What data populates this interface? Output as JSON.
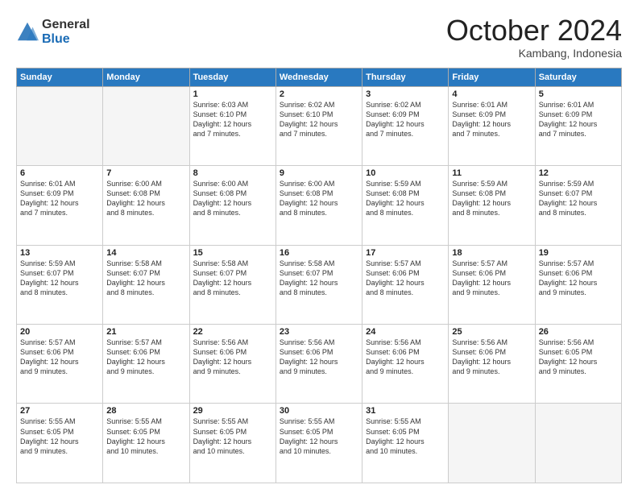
{
  "header": {
    "logo_general": "General",
    "logo_blue": "Blue",
    "month_title": "October 2024",
    "location": "Kambang, Indonesia"
  },
  "calendar": {
    "days_of_week": [
      "Sunday",
      "Monday",
      "Tuesday",
      "Wednesday",
      "Thursday",
      "Friday",
      "Saturday"
    ],
    "weeks": [
      [
        {
          "num": "",
          "info": "",
          "empty": true
        },
        {
          "num": "",
          "info": "",
          "empty": true
        },
        {
          "num": "1",
          "info": "Sunrise: 6:03 AM\nSunset: 6:10 PM\nDaylight: 12 hours\nand 7 minutes."
        },
        {
          "num": "2",
          "info": "Sunrise: 6:02 AM\nSunset: 6:10 PM\nDaylight: 12 hours\nand 7 minutes."
        },
        {
          "num": "3",
          "info": "Sunrise: 6:02 AM\nSunset: 6:09 PM\nDaylight: 12 hours\nand 7 minutes."
        },
        {
          "num": "4",
          "info": "Sunrise: 6:01 AM\nSunset: 6:09 PM\nDaylight: 12 hours\nand 7 minutes."
        },
        {
          "num": "5",
          "info": "Sunrise: 6:01 AM\nSunset: 6:09 PM\nDaylight: 12 hours\nand 7 minutes."
        }
      ],
      [
        {
          "num": "6",
          "info": "Sunrise: 6:01 AM\nSunset: 6:09 PM\nDaylight: 12 hours\nand 7 minutes."
        },
        {
          "num": "7",
          "info": "Sunrise: 6:00 AM\nSunset: 6:08 PM\nDaylight: 12 hours\nand 8 minutes."
        },
        {
          "num": "8",
          "info": "Sunrise: 6:00 AM\nSunset: 6:08 PM\nDaylight: 12 hours\nand 8 minutes."
        },
        {
          "num": "9",
          "info": "Sunrise: 6:00 AM\nSunset: 6:08 PM\nDaylight: 12 hours\nand 8 minutes."
        },
        {
          "num": "10",
          "info": "Sunrise: 5:59 AM\nSunset: 6:08 PM\nDaylight: 12 hours\nand 8 minutes."
        },
        {
          "num": "11",
          "info": "Sunrise: 5:59 AM\nSunset: 6:08 PM\nDaylight: 12 hours\nand 8 minutes."
        },
        {
          "num": "12",
          "info": "Sunrise: 5:59 AM\nSunset: 6:07 PM\nDaylight: 12 hours\nand 8 minutes."
        }
      ],
      [
        {
          "num": "13",
          "info": "Sunrise: 5:59 AM\nSunset: 6:07 PM\nDaylight: 12 hours\nand 8 minutes."
        },
        {
          "num": "14",
          "info": "Sunrise: 5:58 AM\nSunset: 6:07 PM\nDaylight: 12 hours\nand 8 minutes."
        },
        {
          "num": "15",
          "info": "Sunrise: 5:58 AM\nSunset: 6:07 PM\nDaylight: 12 hours\nand 8 minutes."
        },
        {
          "num": "16",
          "info": "Sunrise: 5:58 AM\nSunset: 6:07 PM\nDaylight: 12 hours\nand 8 minutes."
        },
        {
          "num": "17",
          "info": "Sunrise: 5:57 AM\nSunset: 6:06 PM\nDaylight: 12 hours\nand 8 minutes."
        },
        {
          "num": "18",
          "info": "Sunrise: 5:57 AM\nSunset: 6:06 PM\nDaylight: 12 hours\nand 9 minutes."
        },
        {
          "num": "19",
          "info": "Sunrise: 5:57 AM\nSunset: 6:06 PM\nDaylight: 12 hours\nand 9 minutes."
        }
      ],
      [
        {
          "num": "20",
          "info": "Sunrise: 5:57 AM\nSunset: 6:06 PM\nDaylight: 12 hours\nand 9 minutes."
        },
        {
          "num": "21",
          "info": "Sunrise: 5:57 AM\nSunset: 6:06 PM\nDaylight: 12 hours\nand 9 minutes."
        },
        {
          "num": "22",
          "info": "Sunrise: 5:56 AM\nSunset: 6:06 PM\nDaylight: 12 hours\nand 9 minutes."
        },
        {
          "num": "23",
          "info": "Sunrise: 5:56 AM\nSunset: 6:06 PM\nDaylight: 12 hours\nand 9 minutes."
        },
        {
          "num": "24",
          "info": "Sunrise: 5:56 AM\nSunset: 6:06 PM\nDaylight: 12 hours\nand 9 minutes."
        },
        {
          "num": "25",
          "info": "Sunrise: 5:56 AM\nSunset: 6:06 PM\nDaylight: 12 hours\nand 9 minutes."
        },
        {
          "num": "26",
          "info": "Sunrise: 5:56 AM\nSunset: 6:05 PM\nDaylight: 12 hours\nand 9 minutes."
        }
      ],
      [
        {
          "num": "27",
          "info": "Sunrise: 5:55 AM\nSunset: 6:05 PM\nDaylight: 12 hours\nand 9 minutes."
        },
        {
          "num": "28",
          "info": "Sunrise: 5:55 AM\nSunset: 6:05 PM\nDaylight: 12 hours\nand 10 minutes."
        },
        {
          "num": "29",
          "info": "Sunrise: 5:55 AM\nSunset: 6:05 PM\nDaylight: 12 hours\nand 10 minutes."
        },
        {
          "num": "30",
          "info": "Sunrise: 5:55 AM\nSunset: 6:05 PM\nDaylight: 12 hours\nand 10 minutes."
        },
        {
          "num": "31",
          "info": "Sunrise: 5:55 AM\nSunset: 6:05 PM\nDaylight: 12 hours\nand 10 minutes."
        },
        {
          "num": "",
          "info": "",
          "empty": true
        },
        {
          "num": "",
          "info": "",
          "empty": true
        }
      ]
    ]
  }
}
